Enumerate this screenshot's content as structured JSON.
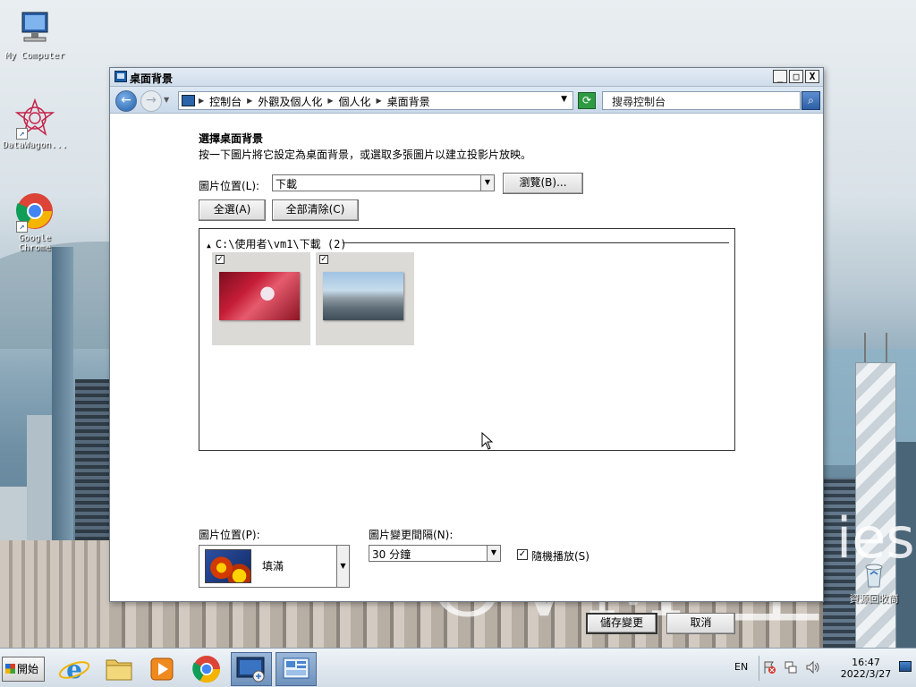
{
  "desktop": {
    "icons": [
      {
        "label": "My Computer",
        "icon": "computer-icon"
      },
      {
        "label": "DataWagon...",
        "icon": "datawagon-icon"
      },
      {
        "label": "Google Chrome",
        "icon": "chrome-icon"
      },
      {
        "label": "資源回收筒",
        "icon": "recycle-bin-icon"
      }
    ],
    "wallpaper_text": [
      "CVM  全",
      "ies"
    ]
  },
  "window": {
    "title": "桌面背景",
    "controls": {
      "minimize": "_",
      "maximize": "□",
      "close": "X"
    },
    "address": {
      "breadcrumbs": [
        "控制台",
        "外觀及個人化",
        "個人化",
        "桌面背景"
      ],
      "search_placeholder": "搜尋控制台"
    },
    "heading": "選擇桌面背景",
    "subtext": "按一下圖片將它設定為桌面背景，或選取多張圖片以建立投影片放映。",
    "location": {
      "label": "圖片位置(L):",
      "value": "下載",
      "browse_button": "瀏覽(B)..."
    },
    "select_all_button": "全選(A)",
    "clear_all_button": "全部清除(C)",
    "gallery": {
      "group_header": "C:\\使用者\\vm1\\下載 (2)",
      "items": [
        {
          "checked": true,
          "kind": "anime-artwork"
        },
        {
          "checked": true,
          "kind": "city-skyline"
        }
      ]
    },
    "position": {
      "label": "圖片位置(P):",
      "value": "填滿"
    },
    "interval": {
      "label": "圖片變更間隔(N):",
      "value": "30 分鐘"
    },
    "shuffle": {
      "label": "隨機播放(S)",
      "checked": true
    },
    "save_button": "儲存變更",
    "cancel_button": "取消"
  },
  "taskbar": {
    "start_label": "開始",
    "pinned": [
      {
        "name": "internet-explorer-icon"
      },
      {
        "name": "file-explorer-icon"
      },
      {
        "name": "media-player-icon"
      },
      {
        "name": "chrome-icon"
      },
      {
        "name": "remote-desktop-icon"
      },
      {
        "name": "control-panel-icon"
      }
    ],
    "language": "EN",
    "time": "16:47",
    "date": "2022/3/27"
  },
  "colors": {
    "window_accent": "#1c5ea8",
    "refresh_green": "#2e9b43"
  }
}
